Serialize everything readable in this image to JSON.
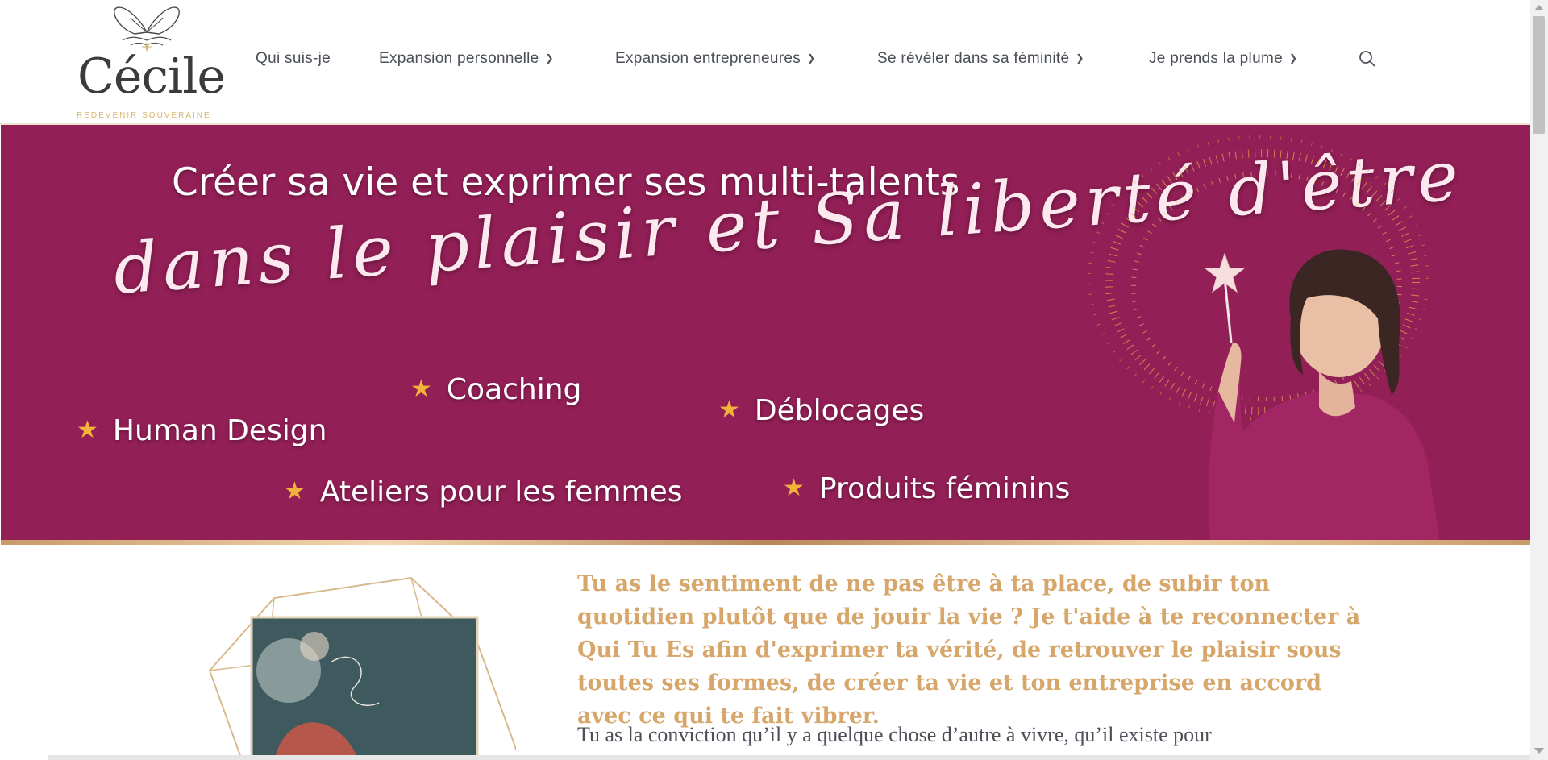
{
  "site": {
    "logo_name": "Cécile",
    "logo_tagline": "REDEVENIR SOUVERAINE"
  },
  "nav": {
    "items": [
      {
        "label": "Qui suis-je",
        "has_dropdown": false
      },
      {
        "label": "Expansion personnelle",
        "has_dropdown": true
      },
      {
        "label": "Expansion entrepreneures",
        "has_dropdown": true
      },
      {
        "label": "Se révéler dans sa féminité",
        "has_dropdown": true
      },
      {
        "label": "Je prends la plume",
        "has_dropdown": true
      }
    ],
    "search_icon": "search-icon"
  },
  "hero": {
    "title": "Créer sa vie et exprimer ses multi-talents",
    "script_line": "dans le plaisir et Sa liberté d'être",
    "services": [
      "Coaching",
      "Déblocages",
      "Human Design",
      "Ateliers pour les femmes",
      "Produits féminins"
    ],
    "star_glyph": "★"
  },
  "content": {
    "lead": "Tu as le sentiment de ne pas être à ta place, de subir ton quotidien plutôt que de jouir la vie ? Je t'aide à te reconnecter à Qui Tu Es afin d'exprimer ta vérité, de retrouver le plaisir sous toutes ses formes, de créer ta vie et ton entreprise en accord avec ce qui te fait vibrer.",
    "body": "Tu as la conviction qu’il y a quelque chose d’autre à vivre, qu’il existe pour"
  },
  "colors": {
    "hero_bg": "#921f56",
    "gold": "#d6a66a",
    "star": "#f2b33a",
    "nav_text": "#4a4f58"
  }
}
